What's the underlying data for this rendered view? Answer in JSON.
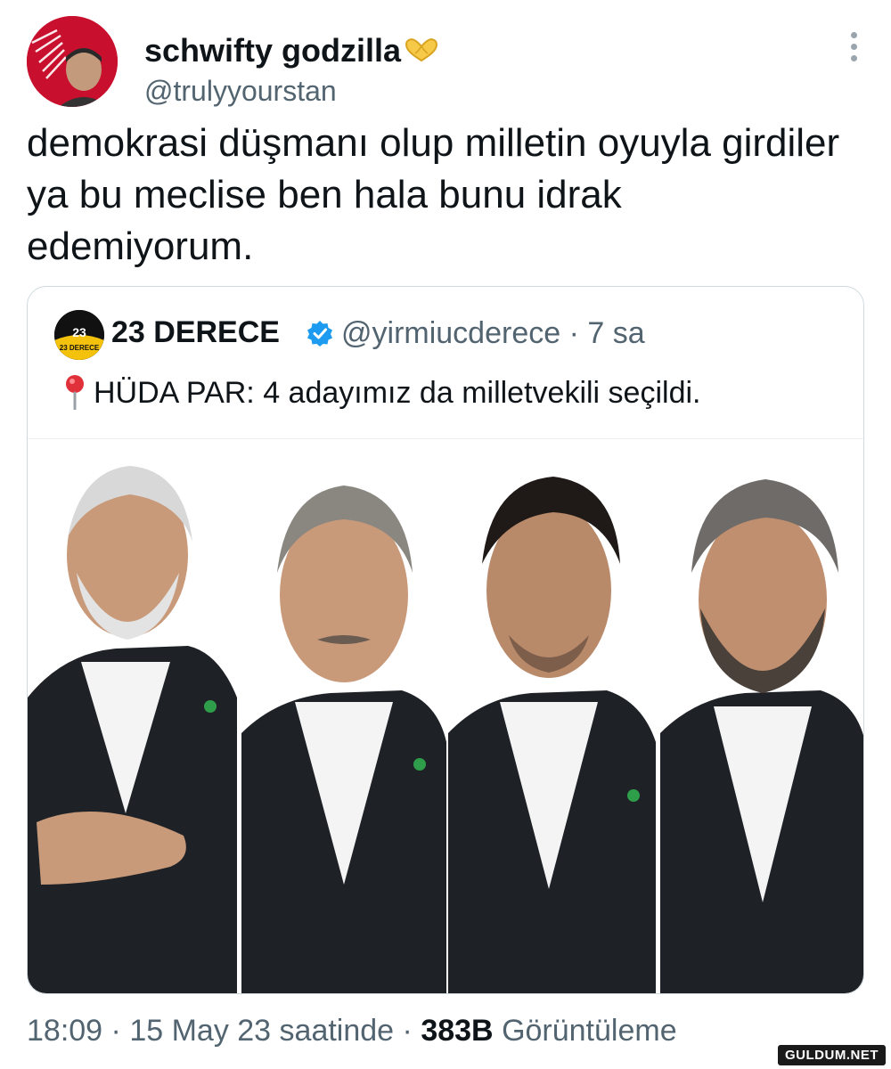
{
  "tweet": {
    "display_name": "schwifty godzilla",
    "name_emoji": "heart-hands-emoji",
    "handle": "@trulyyourstan",
    "text": "demokrasi düşmanı olup milletin oyuyla girdiler ya bu meclise ben hala bunu idrak edemiyorum.",
    "time": "18:09",
    "date": "15 May 23 saatinde",
    "views_count": "383B",
    "views_label": "Görüntüleme",
    "separator": "·"
  },
  "quote": {
    "name": "23 DERECE",
    "handle_time": "@yirmiucderece · 7 sa",
    "avatar_label": "23 DERECE",
    "text": "HÜDA PAR: 4 adayımız da milletvekili seçildi.",
    "media_description": "four-portraits"
  },
  "watermark": "GULDUM.NET",
  "colors": {
    "text": "#0f1419",
    "secondary": "#536471",
    "border": "#cfd9de",
    "verified": "#1d9bf0",
    "suit": "#1e2227",
    "badge": "#2e9e4a"
  }
}
